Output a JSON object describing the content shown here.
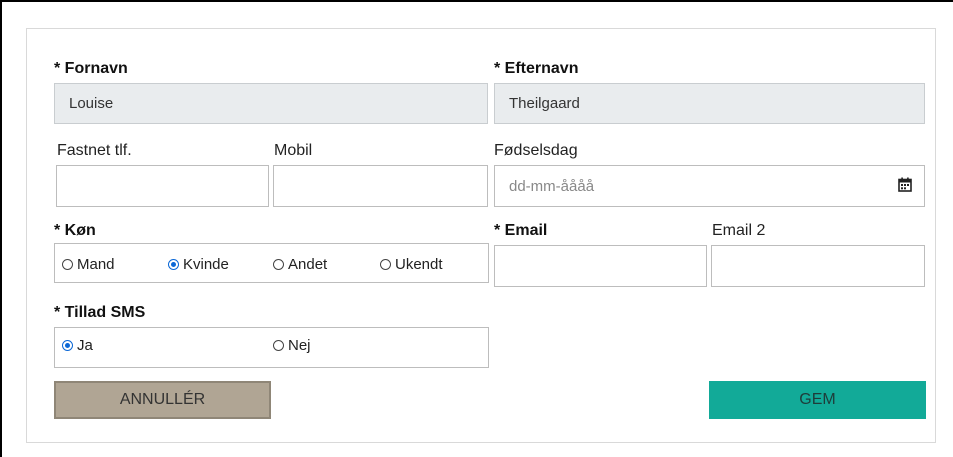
{
  "form": {
    "fornavn": {
      "label": "* Fornavn",
      "value": "Louise"
    },
    "efternavn": {
      "label": "* Efternavn",
      "value": "Theilgaard"
    },
    "fastnet": {
      "label": "Fastnet tlf.",
      "value": ""
    },
    "mobil": {
      "label": "Mobil",
      "value": ""
    },
    "fodselsdag": {
      "label": "Fødselsdag",
      "placeholder": "dd-mm-åååå",
      "icon": "calendar-icon"
    },
    "kon": {
      "label": "* Køn",
      "options": [
        "Mand",
        "Kvinde",
        "Andet",
        "Ukendt"
      ],
      "selected": "Kvinde"
    },
    "email": {
      "label": "* Email",
      "value": ""
    },
    "email2": {
      "label": "Email 2",
      "value": ""
    },
    "sms": {
      "label": "* Tillad SMS",
      "options": [
        "Ja",
        "Nej"
      ],
      "selected": "Ja"
    }
  },
  "buttons": {
    "cancel": {
      "label": "ANNULLÉR",
      "color": "#b0a594"
    },
    "save": {
      "label": "GEM",
      "color": "#12aa98"
    }
  },
  "colors": {
    "radio_selected": "#0a67d6",
    "readonly_bg": "#e9ecee"
  }
}
